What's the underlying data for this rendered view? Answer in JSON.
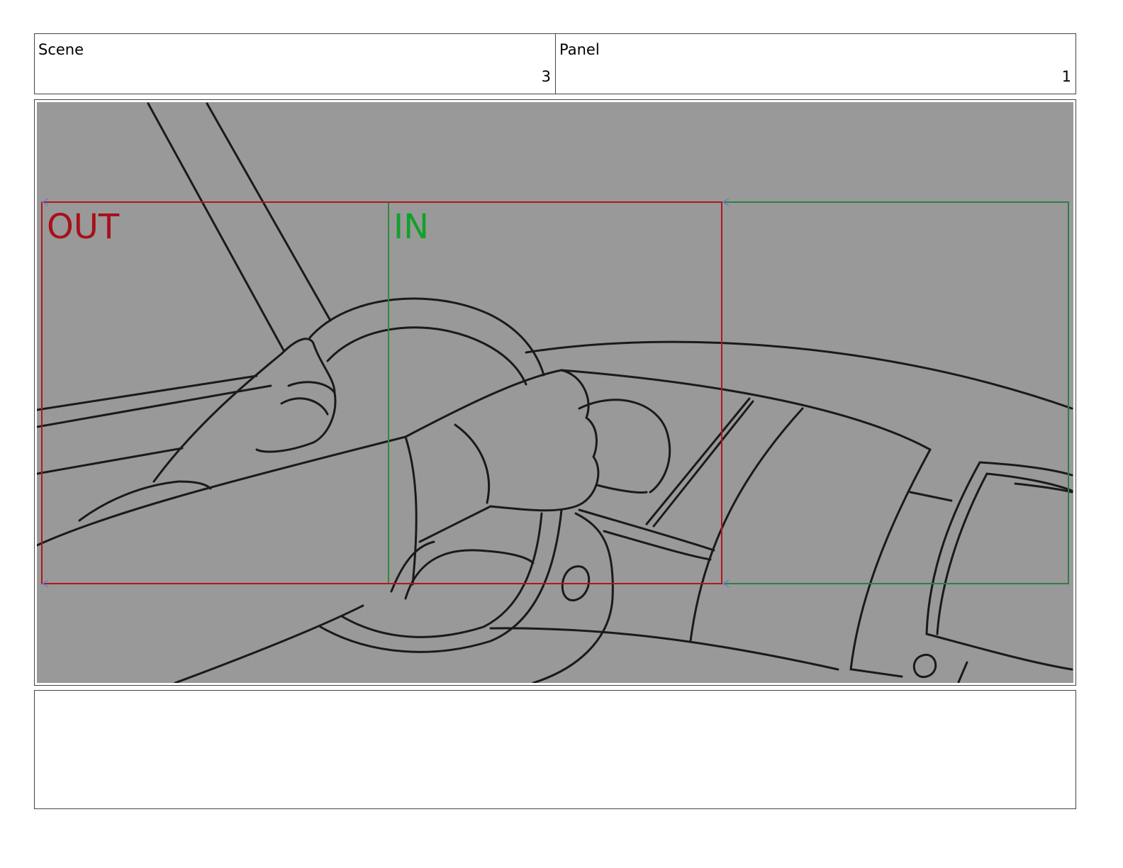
{
  "header": {
    "scene_label": "Scene",
    "scene_value": "3",
    "panel_label": "Panel",
    "panel_value": "1"
  },
  "frame": {
    "out_label": "OUT",
    "in_label": "IN",
    "background_color": "#999999",
    "out_color": "#a8101a",
    "in_color": "#12a12a",
    "path_color": "#2e7d4a"
  },
  "notes": {
    "text": ""
  }
}
